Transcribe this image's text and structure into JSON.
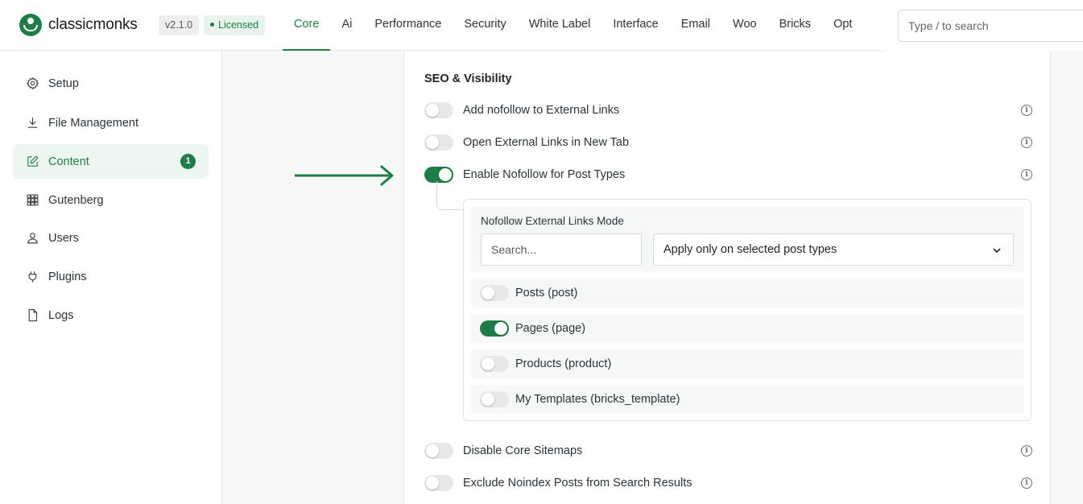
{
  "brand": {
    "name": "classicmonks",
    "version": "v2.1.0",
    "license": "Licensed"
  },
  "nav": [
    {
      "label": "Core",
      "active": true
    },
    {
      "label": "Ai"
    },
    {
      "label": "Performance"
    },
    {
      "label": "Security"
    },
    {
      "label": "White Label"
    },
    {
      "label": "Interface"
    },
    {
      "label": "Email"
    },
    {
      "label": "Woo"
    },
    {
      "label": "Bricks"
    },
    {
      "label": "Opt"
    }
  ],
  "search": {
    "placeholder": "Type / to search"
  },
  "sidebar": {
    "items": [
      {
        "label": "Setup",
        "icon": "gear-icon"
      },
      {
        "label": "File Management",
        "icon": "download-icon"
      },
      {
        "label": "Content",
        "icon": "edit-icon",
        "active": true,
        "badge": "1"
      },
      {
        "label": "Gutenberg",
        "icon": "grid-icon"
      },
      {
        "label": "Users",
        "icon": "user-icon"
      },
      {
        "label": "Plugins",
        "icon": "plug-icon"
      },
      {
        "label": "Logs",
        "icon": "file-icon"
      }
    ]
  },
  "section": {
    "title": "SEO & Visibility",
    "settings": [
      {
        "label": "Add nofollow to External Links",
        "enabled": false
      },
      {
        "label": "Open External Links in New Tab",
        "enabled": false
      },
      {
        "label": "Enable Nofollow for Post Types",
        "enabled": true
      },
      {
        "label": "Disable Core Sitemaps",
        "enabled": false
      },
      {
        "label": "Exclude Noindex Posts from Search Results",
        "enabled": false
      }
    ],
    "nofollow": {
      "mode_title": "Nofollow External Links Mode",
      "search_placeholder": "Search...",
      "mode_selected": "Apply only on selected post types",
      "post_types": [
        {
          "label": "Posts (post)",
          "enabled": false
        },
        {
          "label": "Pages (page)",
          "enabled": true
        },
        {
          "label": "Products (product)",
          "enabled": false
        },
        {
          "label": "My Templates (bricks_template)",
          "enabled": false
        }
      ]
    }
  },
  "colors": {
    "accent": "#1e7d46",
    "toggle_off": "#e6e8ea"
  }
}
